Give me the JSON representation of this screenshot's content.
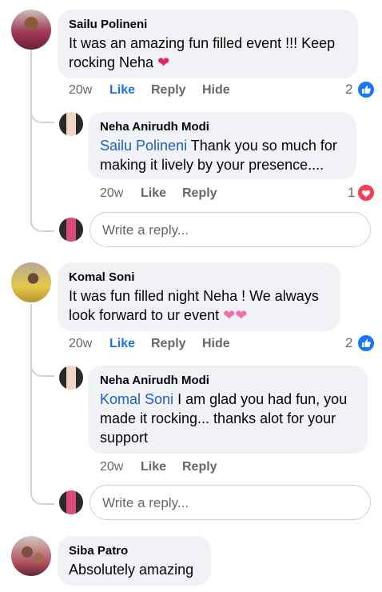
{
  "comments": [
    {
      "author": "Sailu Polineni",
      "text_line1": "It was an amazing fun filled event !!! Keep",
      "text_line2": "rocking Neha",
      "emoji": "❤️",
      "time": "20w",
      "like": "Like",
      "reply": "Reply",
      "hide": "Hide",
      "reaction_count": "2",
      "reply_item": {
        "author": "Neha Anirudh Modi",
        "mention": "Sailu Polineni",
        "text_line1_rest": " Thank you so much for",
        "text_line2": "making it lively by your presence....",
        "time": "20w",
        "like": "Like",
        "reply": "Reply",
        "reaction_count": "1"
      },
      "reply_placeholder": "Write a reply..."
    },
    {
      "author": "Komal Soni",
      "text_line1": "It was fun filled night Neha ! We always",
      "text_line2": "look forward to ur event",
      "emoji": "💕",
      "time": "20w",
      "like": "Like",
      "reply": "Reply",
      "hide": "Hide",
      "reaction_count": "2",
      "reply_item": {
        "author": "Neha Anirudh Modi",
        "mention": "Komal Soni",
        "text_line1_rest": " I am glad you had fun, you",
        "text_line2": "made it rocking... thanks alot for your",
        "text_line3": "support",
        "time": "20w",
        "like": "Like",
        "reply": "Reply"
      },
      "reply_placeholder": "Write a reply..."
    },
    {
      "author": "Siba Patro",
      "text_line1": "Absolutely amazing"
    }
  ],
  "colors": {
    "like_blue": "#1b74e4",
    "mention_blue": "#1b5fc4",
    "love_red": "#f33e58",
    "bubble_bg": "#f0f2f5"
  },
  "icons": {
    "like_reaction": "thumbs-up-icon",
    "love_reaction": "heart-icon"
  }
}
